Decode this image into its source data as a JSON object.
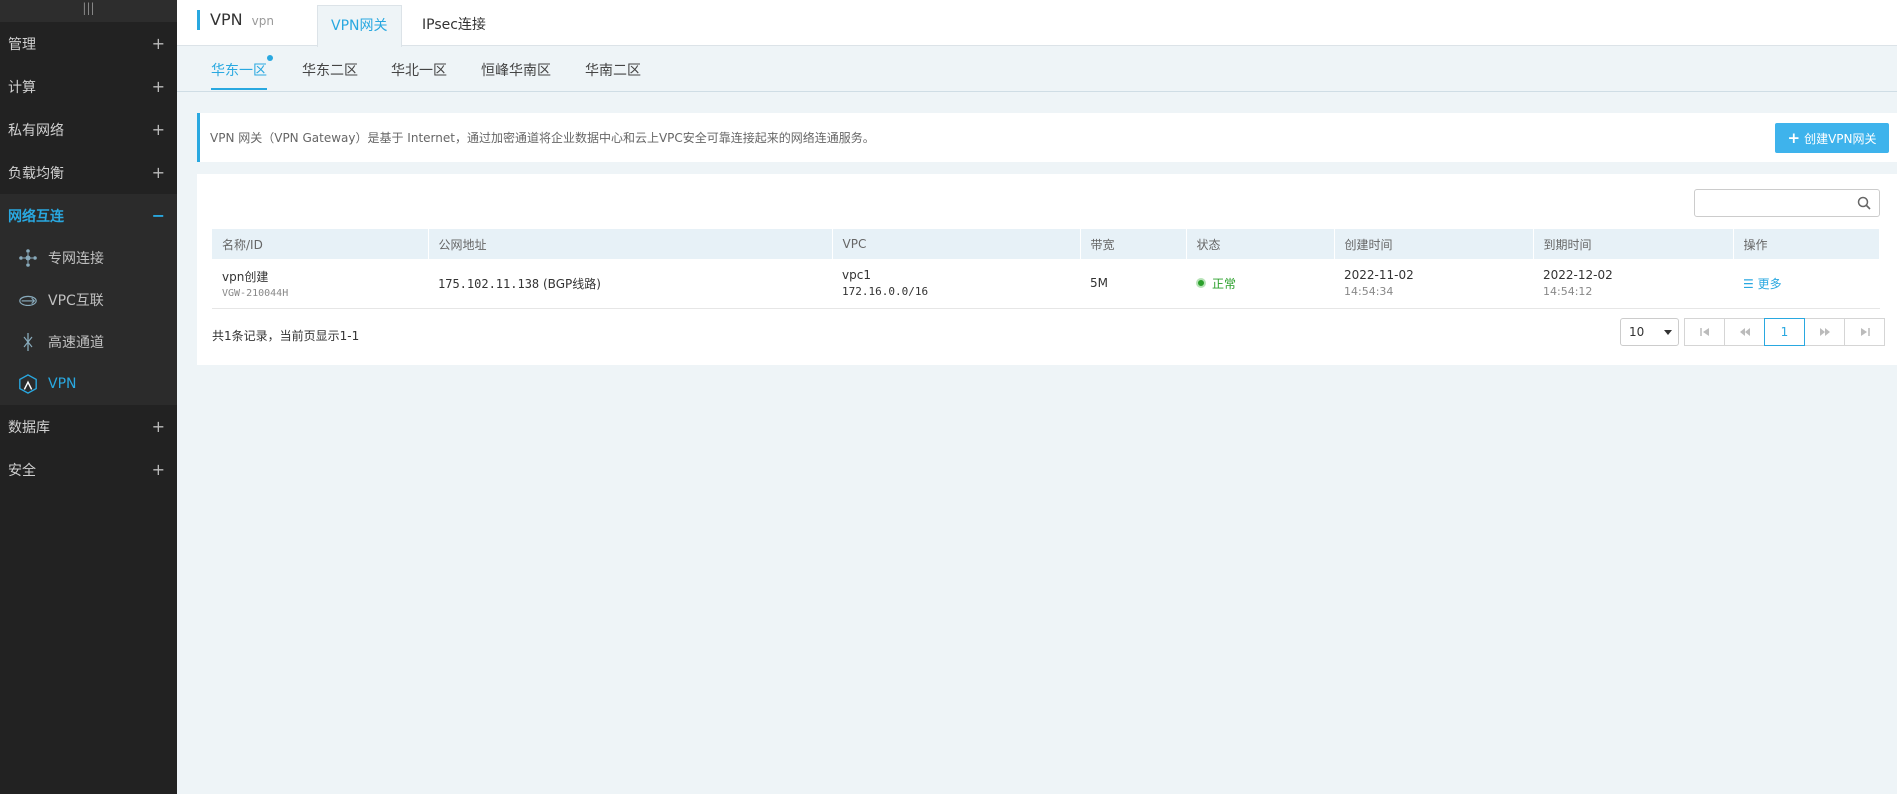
{
  "sidebar": {
    "handle": "|||",
    "groups": [
      {
        "label": "管理",
        "toggle": "+"
      },
      {
        "label": "计算",
        "toggle": "+"
      },
      {
        "label": "私有网络",
        "toggle": "+"
      },
      {
        "label": "负载均衡",
        "toggle": "+"
      },
      {
        "label": "网络互连",
        "toggle": "−"
      },
      {
        "label": "数据库",
        "toggle": "+"
      },
      {
        "label": "安全",
        "toggle": "+"
      }
    ],
    "sub_items": [
      {
        "label": "专网连接",
        "icon": "nodes-icon"
      },
      {
        "label": "VPC互联",
        "icon": "link-icon"
      },
      {
        "label": "高速通道",
        "icon": "channel-icon"
      },
      {
        "label": "VPN",
        "icon": "vpn-shield-icon"
      }
    ]
  },
  "header": {
    "title": "VPN",
    "subtitle": "vpn",
    "tabs": [
      "VPN网关",
      "IPsec连接"
    ]
  },
  "regions": [
    "华东一区",
    "华东二区",
    "华北一区",
    "恒峰华南区",
    "华南二区"
  ],
  "banner": {
    "text": "VPN 网关（VPN Gateway）是基于 Internet，通过加密通道将企业数据中心和云上VPC安全可靠连接起来的网络连通服务。",
    "create_button": "创建VPN网关",
    "create_icon": "+"
  },
  "search": {
    "placeholder": "",
    "icon": "search-icon"
  },
  "table": {
    "columns": [
      "名称/ID",
      "公网地址",
      "VPC",
      "带宽",
      "状态",
      "创建时间",
      "到期时间",
      "操作"
    ],
    "rows": [
      {
        "name": "vpn创建",
        "id": "VGW-210044H",
        "ip": "175.102.11.138",
        "line": "(BGP线路)",
        "vpc_name": "vpc1",
        "vpc_cidr": "172.16.0.0/16",
        "bandwidth": "5M",
        "status": "正常",
        "created_date": "2022-11-02",
        "created_time": "14:54:34",
        "expire_date": "2022-12-02",
        "expire_time": "14:54:12",
        "action": "☰ 更多"
      }
    ]
  },
  "footer": {
    "record_text": "共1条记录，当前页显示1-1",
    "page_size": "10",
    "current_page": "1"
  },
  "colors": {
    "accent": "#29a8e0",
    "sidebar_bg": "#222222",
    "status_ok": "#2ba02b",
    "button_bg": "#3eb3ec"
  }
}
